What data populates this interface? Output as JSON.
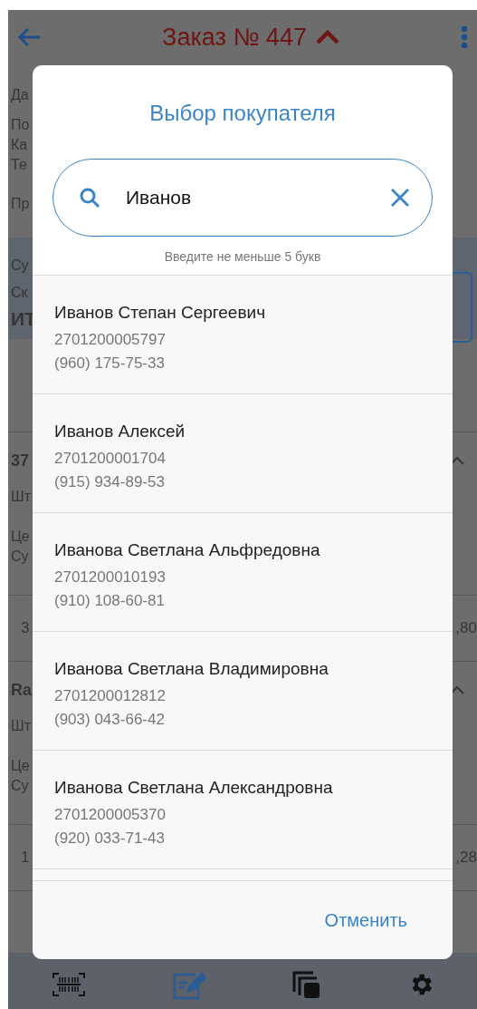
{
  "header": {
    "title": "Заказ № 447"
  },
  "background": {
    "info_lines": [
      "Да",
      "По",
      "Ка",
      "Те",
      "Пр"
    ],
    "summary_lines": [
      "Су",
      "Ск"
    ],
    "summary_total": "ИТ",
    "items": [
      {
        "name": "37",
        "unit": "Шт",
        "price": "Це",
        "sum": "Су",
        "qty": "3",
        "amount": ",80"
      },
      {
        "name": "Ra",
        "unit": "Шт",
        "price": "Це",
        "sum": "Су",
        "qty": "1",
        "amount": ",28"
      }
    ]
  },
  "dialog": {
    "title": "Выбор покупателя",
    "search": {
      "value": "Иванов"
    },
    "hint": "Введите не меньше 5 букв",
    "customers": [
      {
        "name": "Иванов Степан Сергеевич",
        "card": "2701200005797",
        "phone": "(960) 175-75-33"
      },
      {
        "name": "Иванов Алексей",
        "card": "2701200001704",
        "phone": "(915) 934-89-53"
      },
      {
        "name": "Иванова Светлана Альфредовна",
        "card": "2701200010193",
        "phone": "(910) 108-60-81"
      },
      {
        "name": "Иванова Светлана Владимировна",
        "card": "2701200012812",
        "phone": "(903) 043-66-42"
      },
      {
        "name": "Иванова Светлана Александровна",
        "card": "2701200005370",
        "phone": "(920) 033-71-43"
      }
    ],
    "cancel": "Отменить"
  },
  "nav": [
    {
      "kind": "barcode",
      "selected": false
    },
    {
      "kind": "edit",
      "selected": true
    },
    {
      "kind": "copy",
      "selected": false
    },
    {
      "kind": "settings",
      "selected": false
    }
  ]
}
